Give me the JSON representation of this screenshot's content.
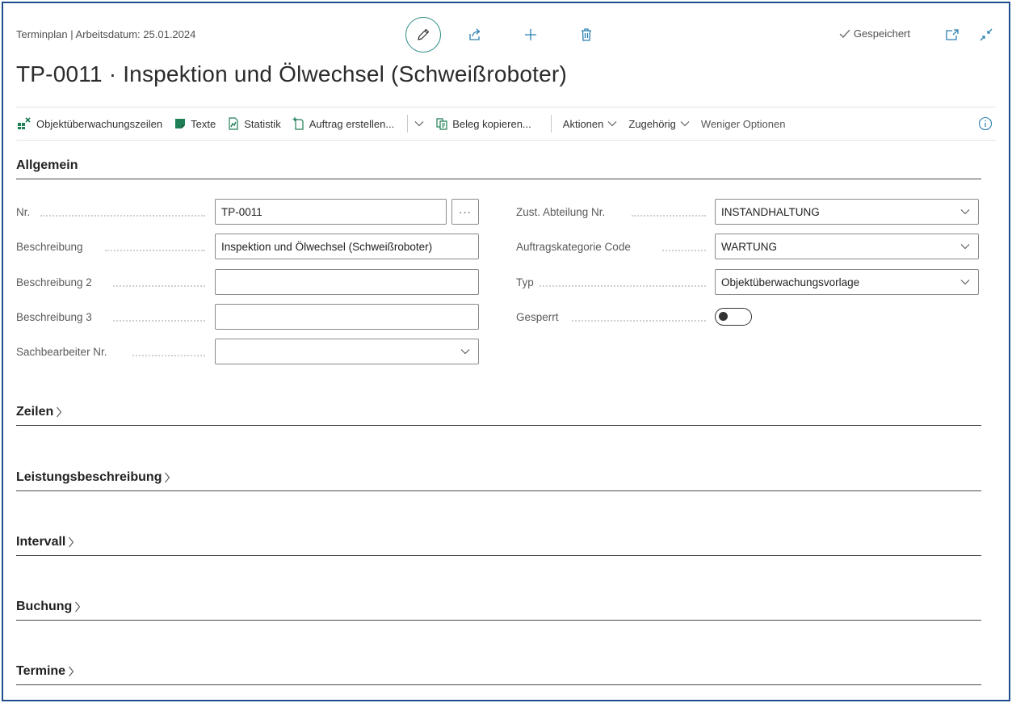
{
  "header": {
    "breadcrumb": "Terminplan | Arbeitsdatum: 25.01.2024",
    "saved_status": "Gespeichert",
    "title": "TP-0011 · Inspektion und Ölwechsel (Schweißroboter)",
    "icons": [
      "pencil-icon",
      "share-icon",
      "plus-icon",
      "trash-icon",
      "open-new-window-icon",
      "collapse-icon"
    ]
  },
  "actions": {
    "objektueberwachungszeilen": "Objektüberwachungszeilen",
    "texte": "Texte",
    "statistik": "Statistik",
    "auftrag_erstellen": "Auftrag erstellen...",
    "beleg_kopieren": "Beleg kopieren...",
    "aktionen": "Aktionen",
    "zugehoerig": "Zugehörig",
    "weniger_optionen": "Weniger Optionen"
  },
  "general": {
    "title": "Allgemein",
    "nr": {
      "label": "Nr.",
      "value": "TP-0011",
      "assist": "···"
    },
    "beschreibung": {
      "label": "Beschreibung",
      "value": "Inspektion und Ölwechsel (Schweißroboter)"
    },
    "beschreibung2": {
      "label": "Beschreibung 2",
      "value": ""
    },
    "beschreibung3": {
      "label": "Beschreibung 3",
      "value": ""
    },
    "sachbearbeiter": {
      "label": "Sachbearbeiter Nr.",
      "value": ""
    },
    "abteilung": {
      "label": "Zust. Abteilung Nr.",
      "value": "INSTANDHALTUNG"
    },
    "auftragskategorie": {
      "label": "Auftragskategorie Code",
      "value": "WARTUNG"
    },
    "typ": {
      "label": "Typ",
      "value": "Objektüberwachungsvorlage"
    },
    "gesperrt": {
      "label": "Gesperrt",
      "checked": false
    }
  },
  "sections": {
    "zeilen": "Zeilen",
    "leistungsbeschreibung": "Leistungsbeschreibung",
    "intervall": "Intervall",
    "buchung": "Buchung",
    "termine": "Termine"
  },
  "colors": {
    "accent": "#2a8a86",
    "frame": "#1f4e8c",
    "action_green": "#1e7f55"
  }
}
